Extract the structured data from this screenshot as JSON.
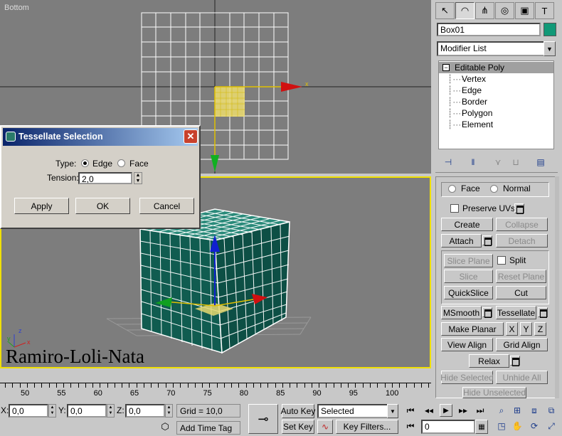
{
  "viewport_top": {
    "label": "Bottom"
  },
  "viewport_persp": {
    "watermark": "Ramiro-Loli-Nata"
  },
  "command_panel": {
    "tab_icons": [
      "create-icon",
      "modify-icon",
      "hierarchy-icon",
      "motion-icon",
      "display-icon",
      "utilities-icon"
    ],
    "object_name": "Box01",
    "object_color": "#119977",
    "modifier_list": "Modifier List",
    "stack": {
      "root": "Editable Poly",
      "sub": [
        "Vertex",
        "Edge",
        "Border",
        "Polygon",
        "Element"
      ]
    },
    "face_label": "Face",
    "normal_label": "Normal",
    "preserve_uvs": "Preserve UVs",
    "create": "Create",
    "collapse": "Collapse",
    "attach": "Attach",
    "detach": "Detach",
    "slice_plane": "Slice Plane",
    "split": "Split",
    "slice": "Slice",
    "reset_plane": "Reset Plane",
    "quickslice": "QuickSlice",
    "cut": "Cut",
    "msmooth": "MSmooth",
    "tessellate": "Tessellate",
    "make_planar": "Make Planar",
    "x": "X",
    "y": "Y",
    "z": "Z",
    "view_align": "View Align",
    "grid_align": "Grid Align",
    "relax": "Relax",
    "hide_selected": "Hide Selected",
    "unhide_all": "Unhide All",
    "hide_unselected": "Hide Unselected"
  },
  "dialog": {
    "title": "Tessellate Selection",
    "type_label": "Type:",
    "edge": "Edge",
    "face": "Face",
    "selected_type": "Edge",
    "tension_label": "Tension:",
    "tension_value": "2,0",
    "apply": "Apply",
    "ok": "OK",
    "cancel": "Cancel"
  },
  "timeline": {
    "ticks": [
      "50",
      "55",
      "60",
      "65",
      "70",
      "75",
      "80",
      "85",
      "90",
      "95",
      "100"
    ]
  },
  "status_bar": {
    "x_label": "X:",
    "x_value": "0,0",
    "y_label": "Y:",
    "y_value": "0,0",
    "z_label": "Z:",
    "z_value": "0,0",
    "grid": "Grid = 10,0",
    "add_time_tag": "Add Time Tag",
    "auto_key": "Auto Key",
    "selected": "Selected",
    "set_key": "Set Key",
    "key_filters": "Key Filters...",
    "frame": "0"
  }
}
